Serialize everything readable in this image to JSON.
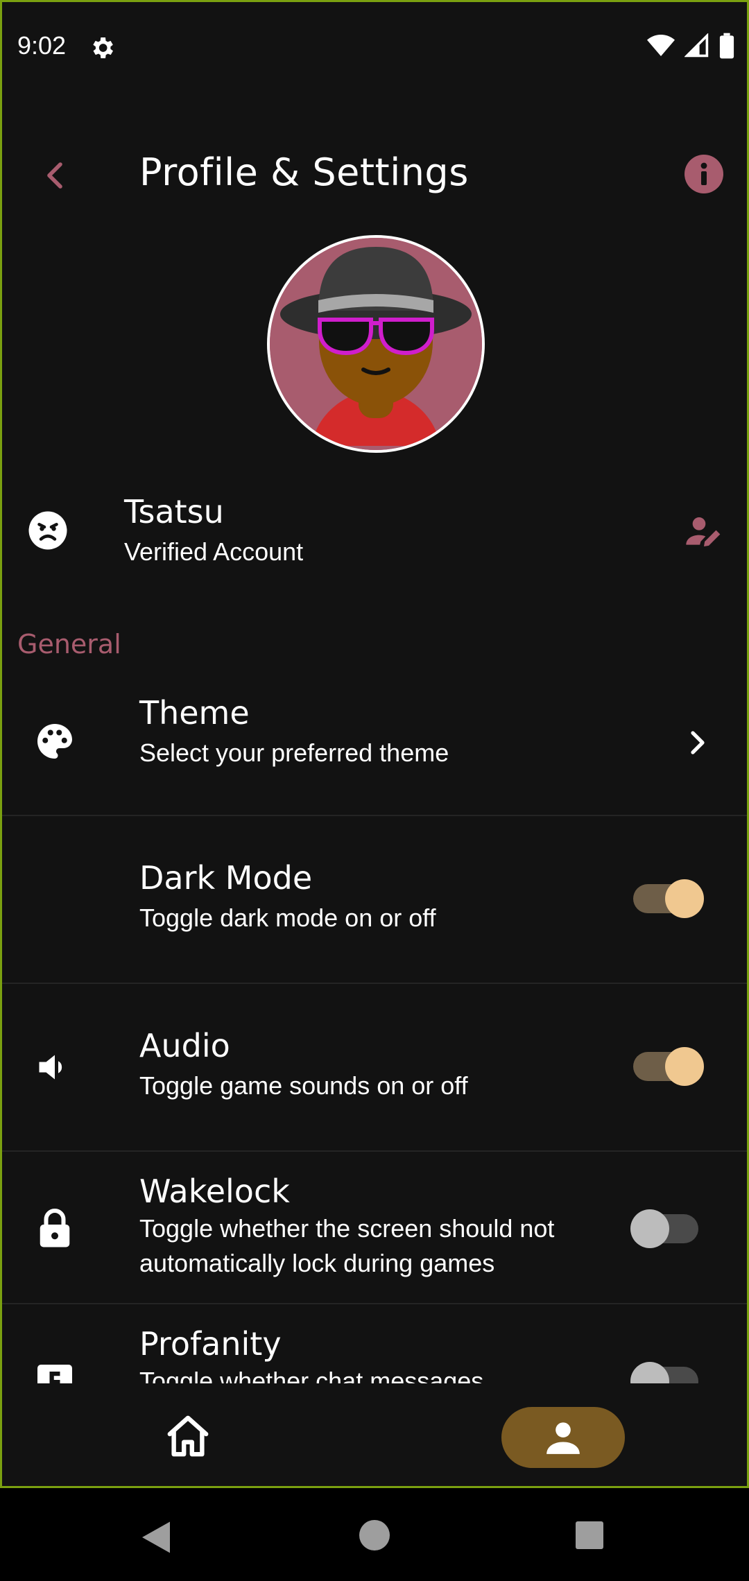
{
  "status_bar": {
    "time": "9:02"
  },
  "header": {
    "title": "Profile & Settings"
  },
  "profile": {
    "name": "Tsatsu",
    "subtitle": "Verified Account"
  },
  "general": {
    "section_label": "General",
    "items": [
      {
        "title": "Theme",
        "description": "Select your preferred theme",
        "control": "chevron",
        "icon": "palette-icon"
      },
      {
        "title": "Dark Mode",
        "description": "Toggle dark mode on or off",
        "control": "toggle",
        "state": "on",
        "icon": "moon-icon"
      },
      {
        "title": "Audio",
        "description": "Toggle game sounds on or off",
        "control": "toggle",
        "state": "on",
        "icon": "speaker-icon"
      },
      {
        "title": "Wakelock",
        "description": "Toggle whether the screen should not automatically lock during games",
        "control": "toggle",
        "state": "off",
        "icon": "lock-icon"
      },
      {
        "title": "Profanity",
        "description": "Toggle whether chat messages",
        "control": "toggle",
        "state": "off",
        "icon": "explicit-icon"
      }
    ]
  },
  "colors": {
    "background": "#121212",
    "accent": "#a85c6e",
    "toggle_on_thumb": "#f0c890",
    "nav_active": "#7a5a22"
  }
}
